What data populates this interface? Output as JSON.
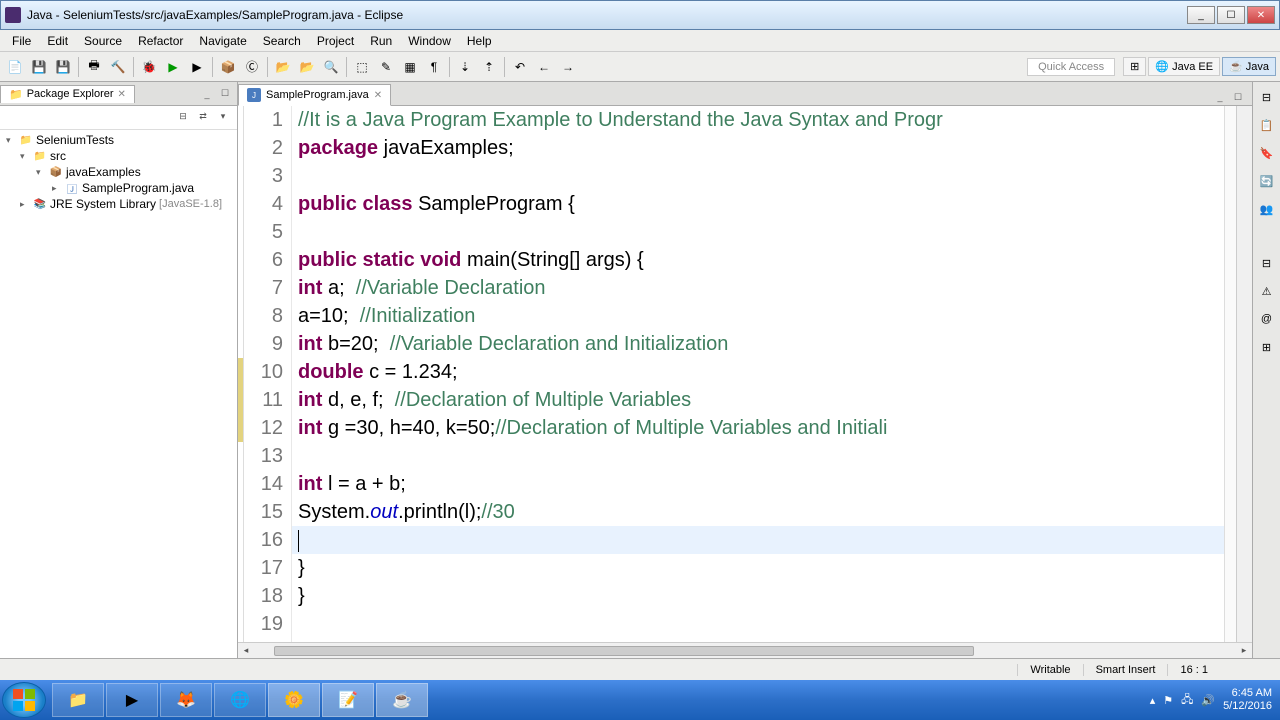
{
  "window": {
    "title": "Java - SeleniumTests/src/javaExamples/SampleProgram.java - Eclipse"
  },
  "menubar": [
    "File",
    "Edit",
    "Source",
    "Refactor",
    "Navigate",
    "Search",
    "Project",
    "Run",
    "Window",
    "Help"
  ],
  "quick_access": "Quick Access",
  "perspectives": {
    "java_ee": "Java EE",
    "java": "Java"
  },
  "package_explorer": {
    "title": "Package Explorer",
    "tree": {
      "project": "SeleniumTests",
      "src": "src",
      "pkg": "javaExamples",
      "file": "SampleProgram.java",
      "jre": "JRE System Library",
      "jre_suffix": "[JavaSE-1.8]"
    }
  },
  "editor": {
    "tab": "SampleProgram.java",
    "lines": [
      {
        "n": 1,
        "seg": [
          {
            "t": "//It is a Java Program Example to Understand the Java Syntax and Progr",
            "c": "cm"
          }
        ]
      },
      {
        "n": 2,
        "seg": [
          {
            "t": "package",
            "c": "kw"
          },
          {
            "t": " javaExamples;"
          }
        ]
      },
      {
        "n": 3,
        "seg": []
      },
      {
        "n": 4,
        "seg": [
          {
            "t": "public",
            "c": "kw"
          },
          {
            "t": " "
          },
          {
            "t": "class",
            "c": "kw"
          },
          {
            "t": " SampleProgram {"
          }
        ]
      },
      {
        "n": 5,
        "seg": []
      },
      {
        "n": 6,
        "seg": [
          {
            "t": "public",
            "c": "kw"
          },
          {
            "t": " "
          },
          {
            "t": "static",
            "c": "kw"
          },
          {
            "t": " "
          },
          {
            "t": "void",
            "c": "kw"
          },
          {
            "t": " main(String[] args) {"
          }
        ]
      },
      {
        "n": 7,
        "seg": [
          {
            "t": "int",
            "c": "kw"
          },
          {
            "t": " a;  "
          },
          {
            "t": "//Variable Declaration",
            "c": "cm"
          }
        ]
      },
      {
        "n": 8,
        "seg": [
          {
            "t": "a=10;  "
          },
          {
            "t": "//Initialization",
            "c": "cm"
          }
        ]
      },
      {
        "n": 9,
        "seg": [
          {
            "t": "int",
            "c": "kw"
          },
          {
            "t": " b=20;  "
          },
          {
            "t": "//Variable Declaration and Initialization",
            "c": "cm"
          }
        ]
      },
      {
        "n": 10,
        "seg": [
          {
            "t": "double",
            "c": "kw"
          },
          {
            "t": " c = 1.234;"
          }
        ],
        "warn": true
      },
      {
        "n": 11,
        "seg": [
          {
            "t": "int",
            "c": "kw"
          },
          {
            "t": " d, e, f;  "
          },
          {
            "t": "//Declaration of Multiple Variables",
            "c": "cm"
          }
        ],
        "warn": true
      },
      {
        "n": 12,
        "seg": [
          {
            "t": "int",
            "c": "kw"
          },
          {
            "t": " g =30, h=40, k=50;"
          },
          {
            "t": "//Declaration of Multiple Variables and Initiali",
            "c": "cm"
          }
        ],
        "warn": true
      },
      {
        "n": 13,
        "seg": []
      },
      {
        "n": 14,
        "seg": [
          {
            "t": "int",
            "c": "kw"
          },
          {
            "t": " l = a + b;"
          }
        ]
      },
      {
        "n": 15,
        "seg": [
          {
            "t": "System."
          },
          {
            "t": "out",
            "c": "fld"
          },
          {
            "t": ".println(l);"
          },
          {
            "t": "//30",
            "c": "cm"
          }
        ]
      },
      {
        "n": 16,
        "seg": [],
        "current": true
      },
      {
        "n": 17,
        "seg": [
          {
            "t": "}"
          }
        ]
      },
      {
        "n": 18,
        "seg": [
          {
            "t": "}"
          }
        ]
      },
      {
        "n": 19,
        "seg": []
      }
    ]
  },
  "statusbar": {
    "writable": "Writable",
    "insert": "Smart Insert",
    "pos": "16 : 1"
  },
  "tray": {
    "time": "6:45 AM",
    "date": "5/12/2016"
  }
}
